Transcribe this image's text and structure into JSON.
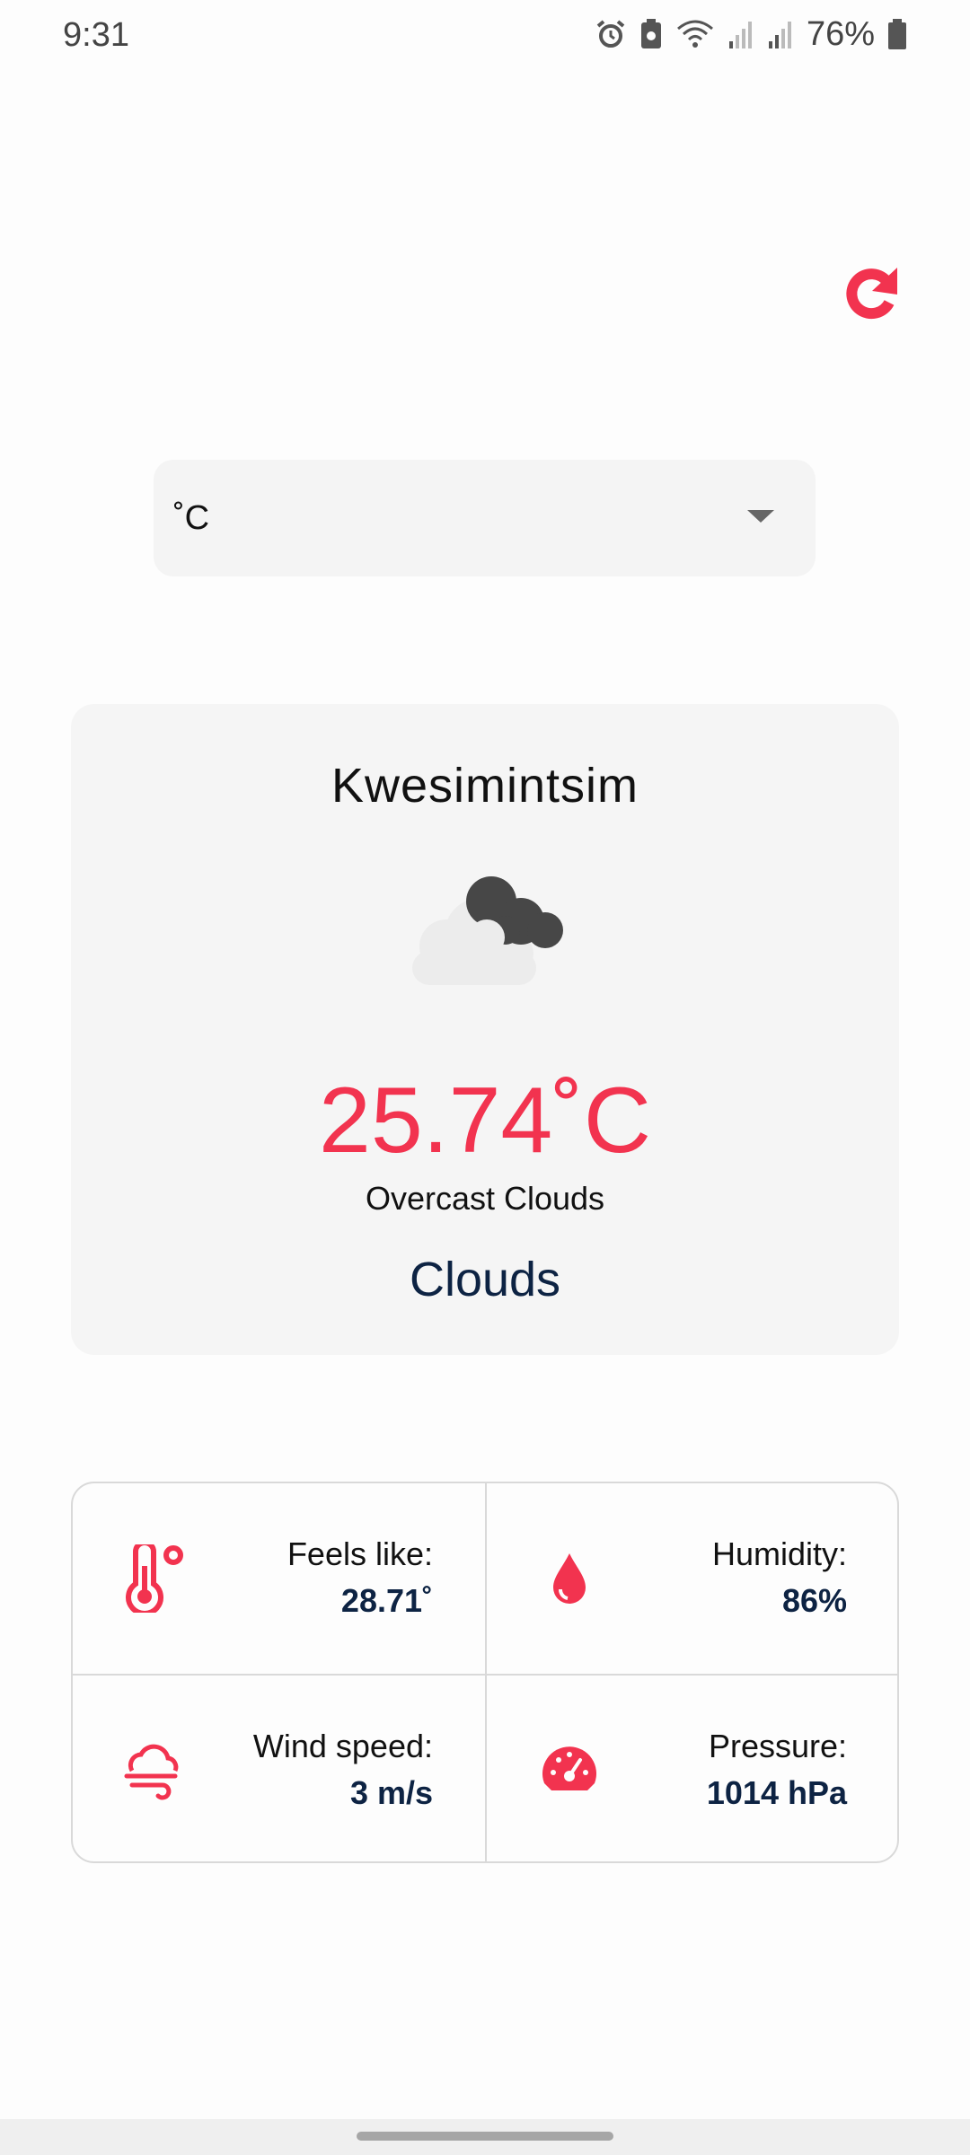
{
  "status_bar": {
    "time": "9:31",
    "battery_percent": "76%",
    "icons": [
      "alarm-icon",
      "battery-saver-icon",
      "wifi-icon",
      "signal-icon",
      "signal-icon",
      "battery-icon"
    ]
  },
  "toolbar": {
    "refresh_icon": "refresh-icon"
  },
  "unit_select": {
    "selected": "˚C",
    "caret_icon": "chevron-down-icon"
  },
  "weather": {
    "city": "Kwesimintsim",
    "icon": "clouds-icon",
    "temperature": "25.74˚C",
    "description": "Overcast Clouds",
    "main": "Clouds"
  },
  "stats": {
    "feels_like": {
      "label": "Feels like:",
      "value": "28.71˚",
      "icon": "thermometer-icon"
    },
    "humidity": {
      "label": "Humidity:",
      "value": "86%",
      "icon": "water-drop-icon"
    },
    "wind_speed": {
      "label": "Wind speed:",
      "value": "3 m/s",
      "icon": "wind-icon"
    },
    "pressure": {
      "label": "Pressure:",
      "value": "1014 hPa",
      "icon": "gauge-icon"
    }
  },
  "colors": {
    "accent": "#f2334f",
    "navy": "#0d2343",
    "card_bg": "#f5f5f5"
  }
}
